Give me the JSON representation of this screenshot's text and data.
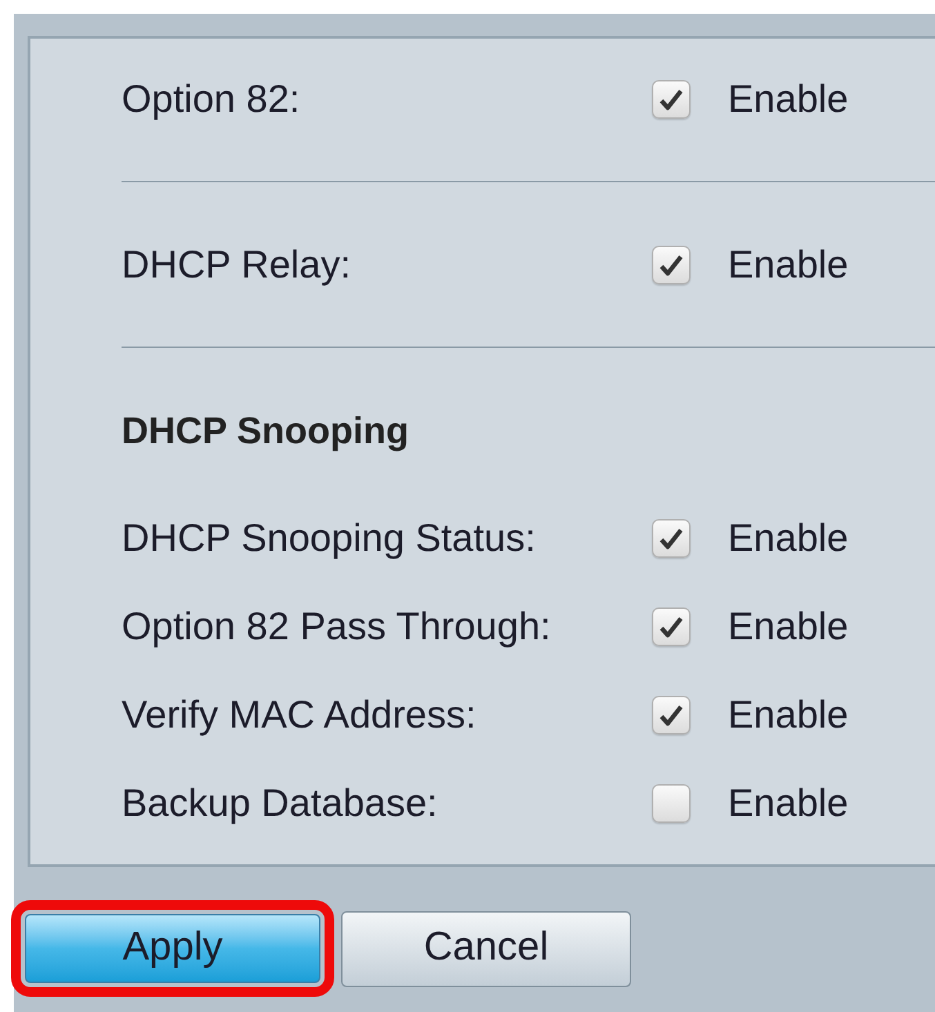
{
  "settings": [
    {
      "kind": "checkbox_row",
      "label": "Option 82:",
      "option": "Enable",
      "checked": true,
      "divider_after": true
    },
    {
      "kind": "checkbox_row",
      "label": "DHCP Relay:",
      "option": "Enable",
      "checked": true,
      "divider_after": true
    },
    {
      "kind": "heading",
      "label": "DHCP Snooping"
    },
    {
      "kind": "checkbox_row",
      "label": "DHCP Snooping Status:",
      "option": "Enable",
      "checked": true
    },
    {
      "kind": "checkbox_row",
      "label": "Option 82 Pass Through:",
      "option": "Enable",
      "checked": true
    },
    {
      "kind": "checkbox_row",
      "label": "Verify MAC Address:",
      "option": "Enable",
      "checked": true
    },
    {
      "kind": "checkbox_row",
      "label": "Backup Database:",
      "option": "Enable",
      "checked": false
    }
  ],
  "buttons": [
    {
      "kind": "primary",
      "label": "Apply",
      "highlighted": true
    },
    {
      "kind": "secondary",
      "label": "Cancel",
      "highlighted": false
    }
  ]
}
